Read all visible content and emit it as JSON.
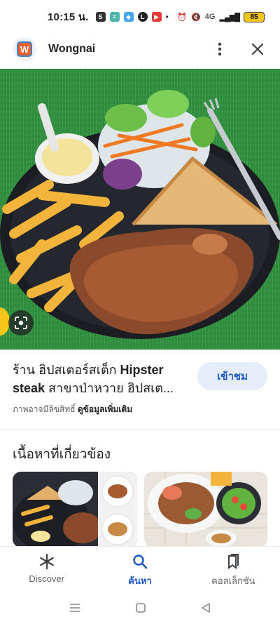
{
  "status_bar": {
    "time": "10:15 น.",
    "battery": "85",
    "network": "4G",
    "signal": "ıılıl"
  },
  "header": {
    "app_name": "Wongnai",
    "logo_letter": "W",
    "icons": [
      "more-vert-icon",
      "close-icon"
    ]
  },
  "result": {
    "title_thai_prefix": "ร้าน ฮิปสเตอร์สเต็ก ",
    "title_bold": "Hipster",
    "title_line2_bold": "steak",
    "title_suffix": " สาขาป่าหวาย ฮิปสเต...",
    "visit_label": "เข้าชม",
    "copyright_text": "ภาพอาจมีลิขสิทธิ์ ",
    "more_info_label": "ดูข้อมูลเพิ่มเติม"
  },
  "related": {
    "heading": "เนื้อหาที่เกี่ยวข้อง"
  },
  "bottom_nav": {
    "items": [
      {
        "label": "Discover",
        "icon": "asterisk-icon"
      },
      {
        "label": "ค้นหา",
        "icon": "search-icon"
      },
      {
        "label": "คอลเล็กชัน",
        "icon": "bookmarks-icon"
      }
    ],
    "active_index": 1
  },
  "colors": {
    "accent": "#1a56c4",
    "visit_bg": "#e6edfa",
    "logo_orange": "#e8622c",
    "logo_blue": "#3d7fd1"
  }
}
